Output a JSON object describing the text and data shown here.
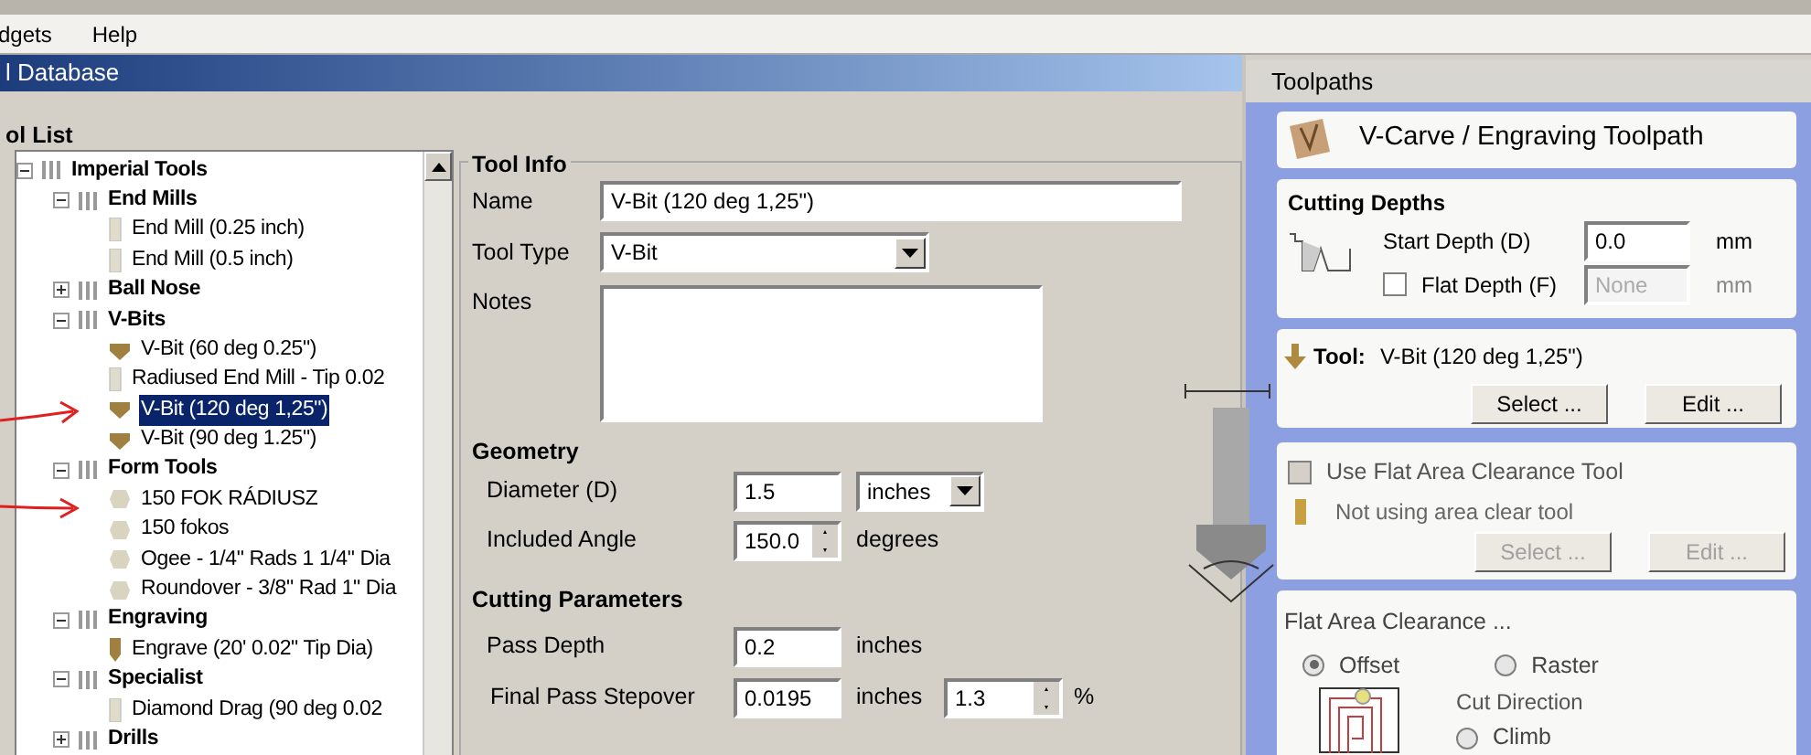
{
  "menu": [
    "dgets",
    "Help"
  ],
  "window": {
    "title": "l Database"
  },
  "tool_list": {
    "label": "ol List",
    "tree": [
      {
        "label": "Imperial Tools",
        "kind": "group",
        "expanded": true,
        "selected": false,
        "children": [
          {
            "label": "End Mills",
            "kind": "group",
            "expanded": true,
            "selected": false,
            "children": [
              {
                "label": "End Mill (0.25 inch)",
                "kind": "endmill",
                "selected": false
              },
              {
                "label": "End Mill (0.5 inch)",
                "kind": "endmill",
                "selected": false
              }
            ]
          },
          {
            "label": "Ball Nose",
            "kind": "group",
            "expanded": false,
            "selected": false
          },
          {
            "label": "V-Bits",
            "kind": "group",
            "expanded": true,
            "selected": false,
            "children": [
              {
                "label": "V-Bit (60 deg 0.25\")",
                "kind": "vbit",
                "selected": false
              },
              {
                "label": "Radiused End Mill - Tip 0.02",
                "kind": "endmill",
                "selected": false
              },
              {
                "label": "V-Bit (120 deg 1,25\")",
                "kind": "vbit",
                "selected": true
              },
              {
                "label": "V-Bit (90 deg 1.25\")",
                "kind": "vbit",
                "selected": false
              }
            ]
          },
          {
            "label": "Form Tools",
            "kind": "group",
            "expanded": true,
            "selected": false,
            "children": [
              {
                "label": "150 FOK RÁDIUSZ",
                "kind": "form",
                "selected": false
              },
              {
                "label": "150 fokos",
                "kind": "form",
                "selected": false
              },
              {
                "label": "Ogee - 1/4\" Rads 1 1/4\" Dia",
                "kind": "form",
                "selected": false
              },
              {
                "label": "Roundover - 3/8\" Rad 1\" Dia",
                "kind": "form",
                "selected": false
              }
            ]
          },
          {
            "label": "Engraving",
            "kind": "group",
            "expanded": true,
            "selected": false,
            "children": [
              {
                "label": "Engrave (20' 0.02\" Tip Dia)",
                "kind": "engrave",
                "selected": false
              }
            ]
          },
          {
            "label": "Specialist",
            "kind": "group",
            "expanded": true,
            "selected": false,
            "children": [
              {
                "label": "Diamond Drag (90 deg 0.02",
                "kind": "endmill",
                "selected": false
              }
            ]
          },
          {
            "label": "Drills",
            "kind": "group",
            "expanded": false,
            "selected": false
          }
        ]
      }
    ]
  },
  "tool_info": {
    "title": "Tool Info",
    "name": {
      "label": "Name",
      "value": "V-Bit (120 deg 1,25\")"
    },
    "tool_type": {
      "label": "Tool Type",
      "value": "V-Bit"
    },
    "notes": {
      "label": "Notes"
    },
    "geometry": {
      "title": "Geometry",
      "diameter": {
        "label": "Diameter (D)",
        "value": "1.5",
        "unit": "inches"
      },
      "included_angle": {
        "label": "Included Angle",
        "value": "150.0",
        "unit": "degrees"
      }
    },
    "cutting_parameters": {
      "title": "Cutting Parameters",
      "pass_depth": {
        "label": "Pass Depth",
        "value": "0.2",
        "unit": "inches"
      },
      "final_pass_stepover": {
        "label": "Final Pass Stepover",
        "value": "0.0195",
        "unit": "inches",
        "percent": "1.3",
        "percent_unit": "%"
      }
    }
  },
  "toolpaths": {
    "title": "Toolpaths",
    "heading": "V-Carve / Engraving Toolpath",
    "cutting_depths": {
      "title": "Cutting Depths",
      "start_depth": {
        "label": "Start Depth (D)",
        "value": "0.0",
        "unit": "mm"
      },
      "flat_depth": {
        "label": "Flat Depth (F)",
        "checked": false,
        "placeholder": "None",
        "unit": "mm"
      }
    },
    "tool": {
      "label": "Tool:",
      "value": "V-Bit (120 deg 1,25\")",
      "buttons": [
        "Select ...",
        "Edit ..."
      ]
    },
    "area_clearance": {
      "label": "Use Flat Area Clearance Tool",
      "checked": false,
      "status": "Not using area clear tool",
      "buttons": [
        "Select ...",
        "Edit ..."
      ]
    },
    "flat_area": {
      "title": "Flat Area Clearance ...",
      "options": [
        {
          "label": "Offset",
          "selected": true
        },
        {
          "label": "Raster",
          "selected": false
        }
      ],
      "cut_direction": {
        "label": "Cut Direction",
        "options": [
          {
            "label": "Climb",
            "selected": false
          }
        ]
      }
    }
  }
}
